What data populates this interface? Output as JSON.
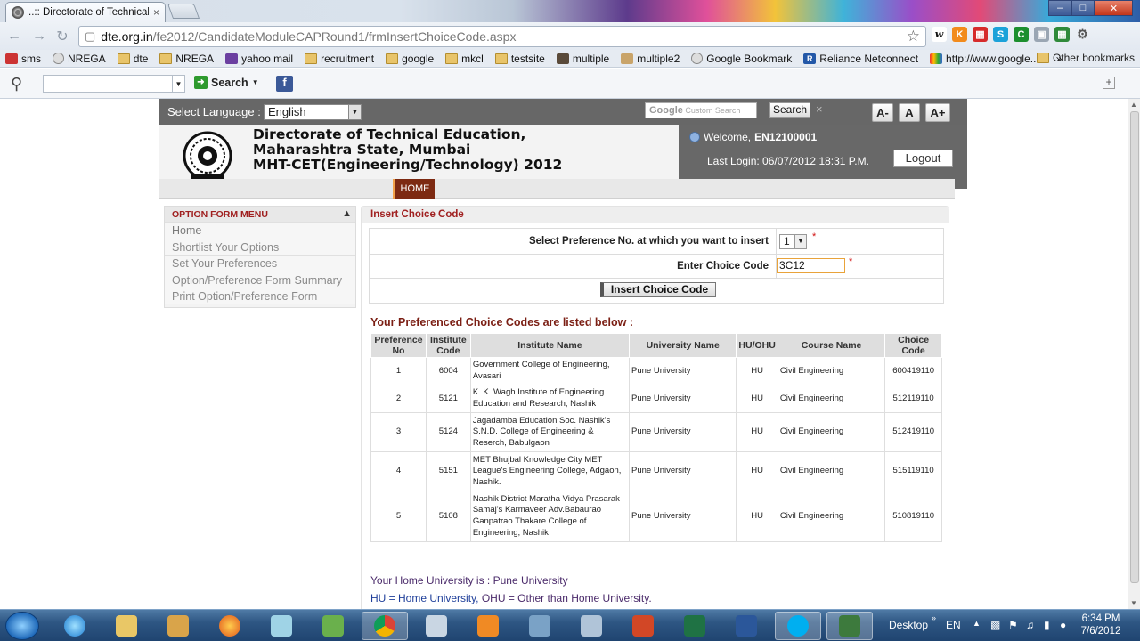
{
  "browser": {
    "tab_title": "..:: Directorate of Technical",
    "tab_close": "×",
    "url_domain": "dte.org.in",
    "url_path": "/fe2012/CandidateModuleCAPRound1/frmInsertChoiceCode.aspx",
    "window_buttons": [
      "–",
      "□",
      "✕"
    ],
    "bookmarks": [
      "sms",
      "NREGA",
      "dte",
      "NREGA",
      "yahoo mail",
      "recruitment",
      "google",
      "mkcl",
      "testsite",
      "multiple",
      "multiple2",
      "Google Bookmark",
      "Reliance Netconnect",
      "http://www.google..."
    ],
    "bookmarks_overflow": "»",
    "other_bookmarks": "Other bookmarks"
  },
  "search_toolbar": {
    "search_label": "Search",
    "fb_label": "f",
    "add_label": "+"
  },
  "header": {
    "select_language_label": "Select Language :",
    "language_value": "English",
    "custom_search_placeholder": "Custom Search",
    "custom_search_brand": "Google",
    "search_button": "Search",
    "search_clear": "×",
    "font_buttons": [
      "A-",
      "A",
      "A+"
    ],
    "org_line1": "Directorate of Technical Education,",
    "org_line2": "Maharashtra State, Mumbai",
    "org_line3": "MHT-CET(Engineering/Technology) 2012",
    "welcome_prefix": "Welcome,",
    "welcome_user": "EN12100001",
    "last_login": "Last Login: 06/07/2012 18:31 P.M.",
    "logout": "Logout",
    "nav_home": "HOME"
  },
  "sidebar": {
    "title": "OPTION FORM MENU",
    "collapse_glyph": "▲",
    "items": [
      "Home",
      "Shortlist Your Options",
      "Set Your Preferences",
      "Option/Preference Form Summary",
      "Print Option/Preference Form"
    ]
  },
  "main": {
    "title": "Insert Choice Code",
    "pref_label": "Select Preference No. at which you want to insert",
    "pref_value": "1",
    "choice_label": "Enter Choice Code",
    "choice_value": "3C12",
    "required_mark": "*",
    "insert_button": "Insert Choice Code",
    "listed_caption": "Your Preferenced Choice Codes are listed below :",
    "table": {
      "headers": [
        "Preference No",
        "Institute Code",
        "Institute Name",
        "University Name",
        "HU/OHU",
        "Course Name",
        "Choice Code"
      ],
      "rows": [
        [
          "1",
          "6004",
          "Government College of Engineering, Avasari",
          "Pune University",
          "HU",
          "Civil Engineering",
          "600419110"
        ],
        [
          "2",
          "5121",
          "K. K. Wagh Institute of Engineering Education and Research, Nashik",
          "Pune University",
          "HU",
          "Civil Engineering",
          "512119110"
        ],
        [
          "3",
          "5124",
          "Jagadamba Education Soc. Nashik's S.N.D. College of Engineering & Reserch, Babulgaon",
          "Pune University",
          "HU",
          "Civil Engineering",
          "512419110"
        ],
        [
          "4",
          "5151",
          "MET Bhujbal Knowledge City MET League's Engineering College, Adgaon, Nashik.",
          "Pune University",
          "HU",
          "Civil Engineering",
          "515119110"
        ],
        [
          "5",
          "5108",
          "Nashik District Maratha Vidya Prasarak Samaj's Karmaveer Adv.Babaurao Ganpatrao Thakare College of Engineering, Nashik",
          "Pune University",
          "HU",
          "Civil Engineering",
          "510819110"
        ]
      ]
    },
    "home_university": "Your Home University is : Pune University",
    "legend_hu": "HU = Home University,",
    "legend_ohu": " OHU = Other than Home University."
  },
  "taskbar": {
    "desktop_label": "Desktop",
    "lang": "EN",
    "time": "6:34 PM",
    "date": "7/6/2012"
  },
  "colors": {
    "header_gray": "#676767",
    "home_tab": "#7d2a12",
    "section_title": "#a02020",
    "input_focus": "#e9a33a"
  }
}
